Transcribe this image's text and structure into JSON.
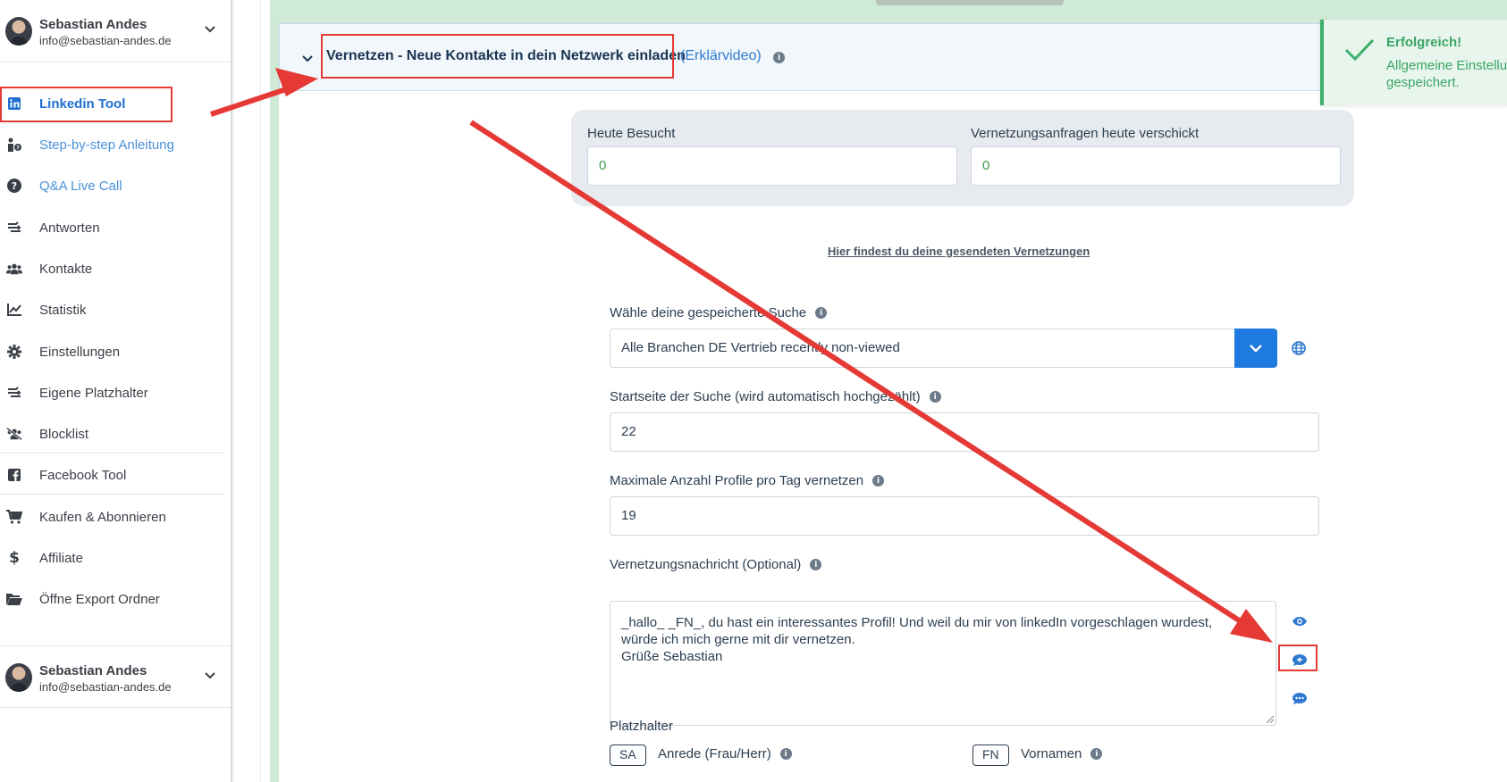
{
  "user": {
    "name": "Sebastian Andes",
    "email": "info@sebastian-andes.de"
  },
  "sidebar": {
    "items": [
      {
        "label": "Linkedin Tool",
        "icon": "linkedin-icon"
      },
      {
        "label": "Step-by-step Anleitung",
        "icon": "person-info-icon"
      },
      {
        "label": "Q&A Live Call",
        "icon": "question-icon"
      },
      {
        "label": "Antworten",
        "icon": "route-icon"
      },
      {
        "label": "Kontakte",
        "icon": "users-icon"
      },
      {
        "label": "Statistik",
        "icon": "chart-line-icon"
      },
      {
        "label": "Einstellungen",
        "icon": "gear-icon"
      },
      {
        "label": "Eigene Platzhalter",
        "icon": "route-icon"
      },
      {
        "label": "Blocklist",
        "icon": "users-slash-icon"
      },
      {
        "label": "Facebook Tool",
        "icon": "facebook-icon"
      },
      {
        "label": "Kaufen & Abonnieren",
        "icon": "cart-icon"
      },
      {
        "label": "Affiliate",
        "icon": "dollar-icon"
      },
      {
        "label": "Öffne Export Ordner",
        "icon": "folder-open-icon"
      }
    ]
  },
  "section": {
    "title": "Vernetzen - Neue Kontakte in dein Netzwerk einladen",
    "video_link": "(Erklärvideo)"
  },
  "stats": {
    "visited_label": "Heute Besucht",
    "visited_value": "0",
    "requests_label": "Vernetzungsanfragen heute verschickt",
    "requests_value": "0"
  },
  "sent_link": "Hier findest du deine gesendeten Vernetzungen",
  "form": {
    "search_label": "Wähle deine gespeicherte Suche",
    "search_value": "Alle Branchen DE Vertrieb recently non-viewed",
    "start_page_label": "Startseite der Suche (wird automatisch hochgezählt)",
    "start_page_value": "22",
    "max_profiles_label": "Maximale Anzahl Profile pro Tag vernetzen",
    "max_profiles_value": "19",
    "message_label": "Vernetzungsnachricht (Optional)",
    "message_value": "_hallo_ _FN_, du hast ein interessantes Profil! Und weil du mir von linkedIn vorgeschlagen wurdest,\nwürde ich mich gerne mit dir vernetzen.\nGrüße Sebastian",
    "placeholder_label": "Platzhalter",
    "placeholders": [
      {
        "code": "SA",
        "text": "Anrede (Frau/Herr)"
      },
      {
        "code": "FN",
        "text": "Vornamen"
      }
    ]
  },
  "toast": {
    "title": "Erfolgreich!",
    "message": "Allgemeine Einstellungen\ngespeichert."
  },
  "colors": {
    "accent": "#1f7ae0",
    "annotation_red": "#e53935",
    "success": "#3aa565"
  }
}
